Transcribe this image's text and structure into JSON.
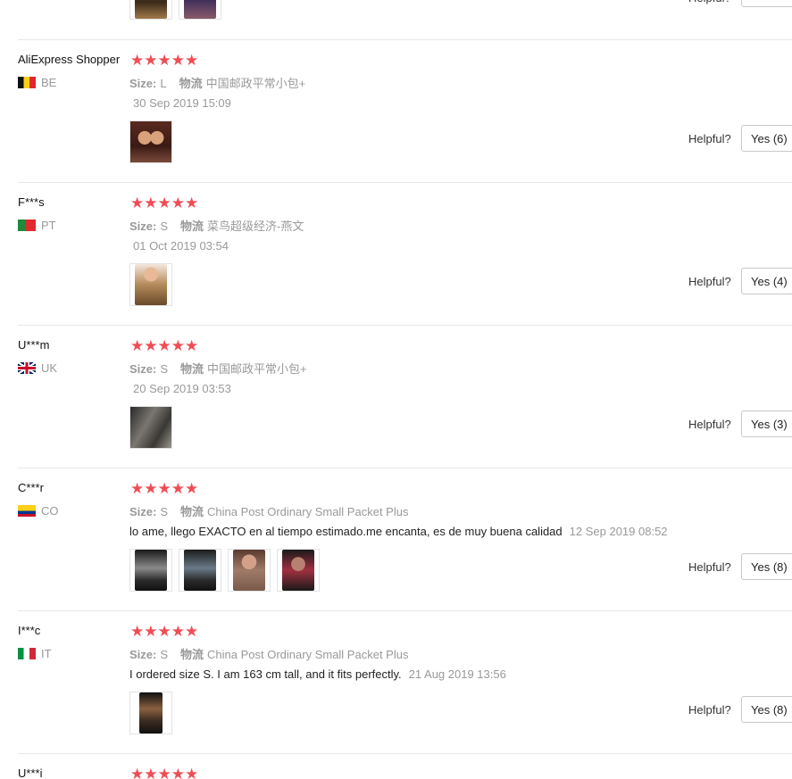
{
  "helpful_label": "Helpful?",
  "reviews": [
    {
      "user": "AliExpress Shopper",
      "country": "BE",
      "flag": "belgium-flag-icon",
      "stars": "★★★★★",
      "size_label": "Size:",
      "size": "L",
      "logistics_label": "物流",
      "logistics": "中国邮政平常小包+",
      "comment": "",
      "date": "30 Sep 2019 15:09",
      "photo_count": 1,
      "yes": "Yes (6)"
    },
    {
      "user": "F***s",
      "country": "PT",
      "flag": "portugal-flag-icon",
      "stars": "★★★★★",
      "size_label": "Size:",
      "size": "S",
      "logistics_label": "物流",
      "logistics": "菜鸟超级经济-燕文",
      "comment": "",
      "date": "01 Oct 2019 03:54",
      "photo_count": 1,
      "yes": "Yes (4)"
    },
    {
      "user": "U***m",
      "country": "UK",
      "flag": "uk-flag-icon",
      "stars": "★★★★★",
      "size_label": "Size:",
      "size": "S",
      "logistics_label": "物流",
      "logistics": "中国邮政平常小包+",
      "comment": "",
      "date": "20 Sep 2019 03:53",
      "photo_count": 1,
      "yes": "Yes (3)"
    },
    {
      "user": "C***r",
      "country": "CO",
      "flag": "colombia-flag-icon",
      "stars": "★★★★★",
      "size_label": "Size:",
      "size": "S",
      "logistics_label": "物流",
      "logistics": "China Post Ordinary Small Packet Plus",
      "comment": "lo ame, llego EXACTO en al tiempo estimado.me encanta, es de muy buena calidad",
      "date": "12 Sep 2019 08:52",
      "photo_count": 4,
      "yes": "Yes (8)"
    },
    {
      "user": "I***c",
      "country": "IT",
      "flag": "italy-flag-icon",
      "stars": "★★★★★",
      "size_label": "Size:",
      "size": "S",
      "logistics_label": "物流",
      "logistics": "China Post Ordinary Small Packet Plus",
      "comment": "I ordered size S. I am 163 cm tall, and it fits perfectly.",
      "date": "21 Aug 2019 13:56",
      "photo_count": 1,
      "yes": "Yes (8)"
    },
    {
      "user": "U***i",
      "stars": "★★★★★"
    }
  ],
  "colors": {
    "star": "#ef4d55",
    "muted": "#999999",
    "divider": "#e8e8e8"
  }
}
